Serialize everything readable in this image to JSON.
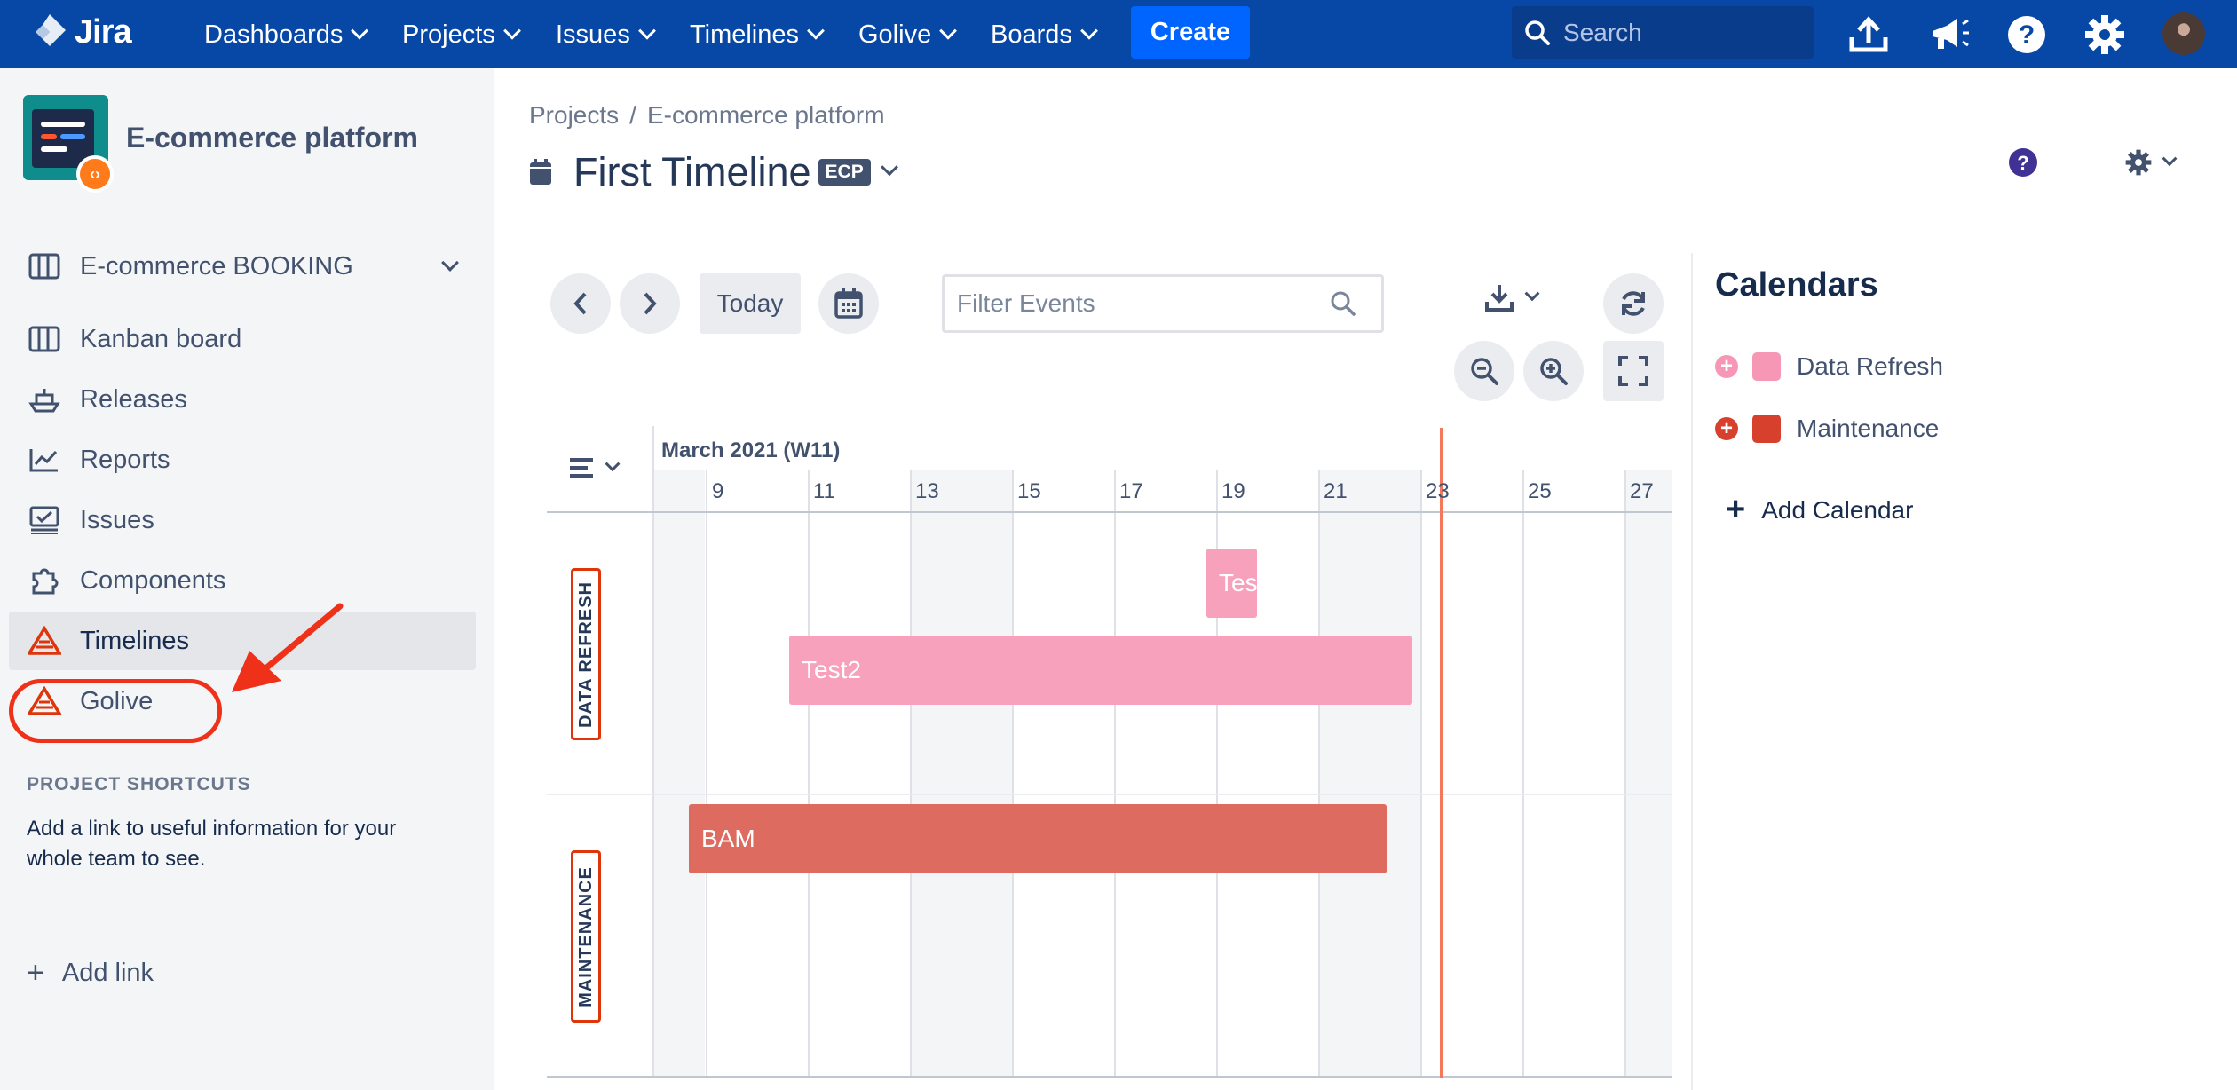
{
  "topnav": {
    "logo_text": "Jira",
    "items": [
      {
        "label": "Dashboards"
      },
      {
        "label": "Projects"
      },
      {
        "label": "Issues"
      },
      {
        "label": "Timelines"
      },
      {
        "label": "Golive"
      },
      {
        "label": "Boards"
      }
    ],
    "create_label": "Create",
    "search_placeholder": "Search"
  },
  "sidebar": {
    "project_name": "E-commerce platform",
    "board_selector": "E-commerce BOOKING",
    "items": [
      {
        "label": "Kanban board"
      },
      {
        "label": "Releases"
      },
      {
        "label": "Reports"
      },
      {
        "label": "Issues"
      },
      {
        "label": "Components"
      },
      {
        "label": "Timelines"
      },
      {
        "label": "Golive"
      }
    ],
    "shortcuts_title": "PROJECT SHORTCUTS",
    "shortcuts_desc": "Add a link to useful information for your whole team to see.",
    "add_link": "Add link"
  },
  "main": {
    "breadcrumb": {
      "root": "Projects",
      "separator": "/",
      "current": "E-commerce platform"
    },
    "title": "First Timeline",
    "badge": "ECP",
    "toolbar": {
      "today_label": "Today",
      "filter_placeholder": "Filter Events"
    },
    "timeline": {
      "month": "March 2021 (W11)",
      "days": [
        "9",
        "11",
        "13",
        "15",
        "17",
        "19",
        "21",
        "23",
        "25",
        "27"
      ],
      "lanes": [
        "DATA REFRESH",
        "MAINTENANCE"
      ],
      "events": [
        {
          "label": "Test",
          "calendar": "Data Refresh",
          "color": "#f7a1bd"
        },
        {
          "label": "Test2",
          "calendar": "Data Refresh",
          "color": "#f7a1bd"
        },
        {
          "label": "BAM",
          "calendar": "Maintenance",
          "color": "#de6b5f"
        }
      ],
      "today_line_color": "#f4785c"
    }
  },
  "calendars": {
    "title": "Calendars",
    "items": [
      {
        "label": "Data Refresh",
        "color": "#f797b6"
      },
      {
        "label": "Maintenance",
        "color": "#d6402c"
      }
    ],
    "add_label": "Add Calendar"
  },
  "colors": {
    "nav_bg": "#0747a6",
    "create_bg": "#0065ff",
    "highlight": "#f0311a"
  }
}
